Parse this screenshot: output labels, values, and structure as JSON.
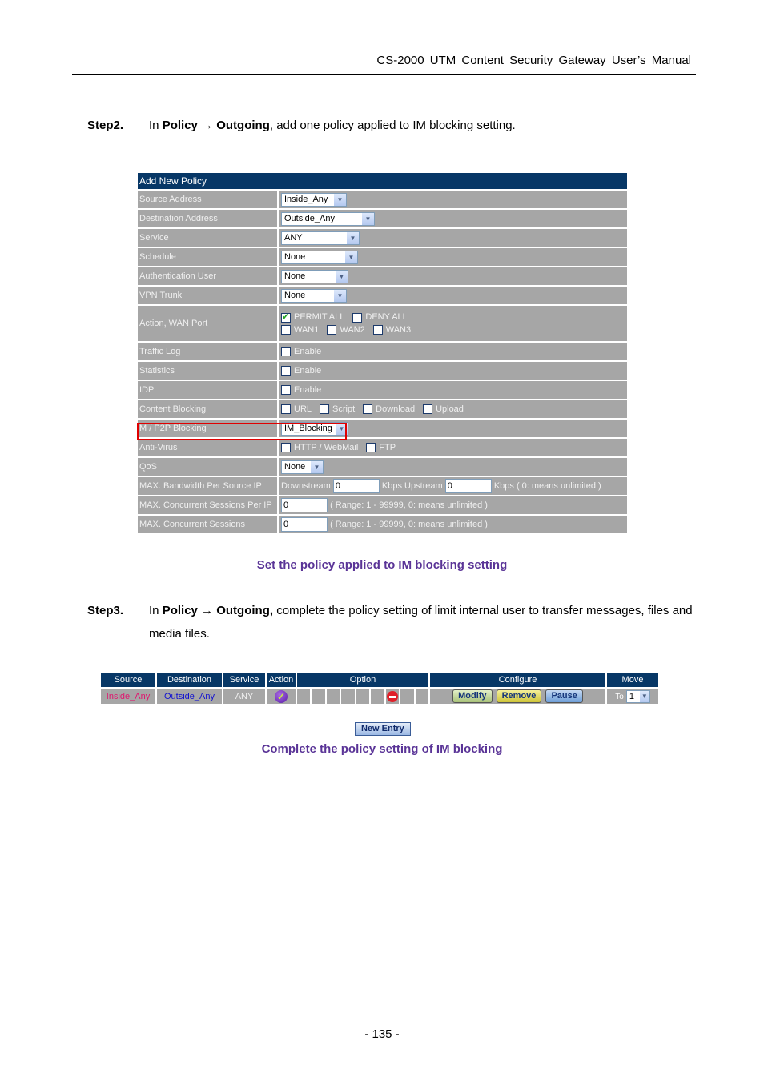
{
  "header": {
    "title": "CS-2000  UTM  Content  Security  Gateway  User’s  Manual"
  },
  "step2": {
    "label": "Step2.",
    "prefix": "In ",
    "path": "Policy → Outgoing",
    "suffix": ", add one policy applied to IM blocking setting."
  },
  "form": {
    "title": "Add New Policy",
    "source_address": {
      "label": "Source Address",
      "value": "Inside_Any"
    },
    "destination_address": {
      "label": "Destination Address",
      "value": "Outside_Any"
    },
    "service": {
      "label": "Service",
      "value": "ANY"
    },
    "schedule": {
      "label": "Schedule",
      "value": "None"
    },
    "auth_user": {
      "label": "Authentication User",
      "value": "None"
    },
    "vpn_trunk": {
      "label": "VPN Trunk",
      "value": "None"
    },
    "action": {
      "label": "Action, WAN Port",
      "permit_all": "PERMIT ALL",
      "permit_all_checked": true,
      "deny_all": "DENY ALL",
      "wan1": "WAN1",
      "wan2": "WAN2",
      "wan3": "WAN3"
    },
    "traffic_log": {
      "label": "Traffic Log",
      "option": "Enable"
    },
    "statistics": {
      "label": "Statistics",
      "option": "Enable"
    },
    "idp": {
      "label": "IDP",
      "option": "Enable"
    },
    "content_blocking": {
      "label": "Content Blocking",
      "url": "URL",
      "script": "Script",
      "download": "Download",
      "upload": "Upload"
    },
    "im_p2p": {
      "label": "M / P2P Blocking",
      "value": "IM_Blocking"
    },
    "anti_virus": {
      "label": "Anti-Virus",
      "http": "HTTP / WebMail",
      "ftp": "FTP"
    },
    "qos": {
      "label": "QoS",
      "value": "None"
    },
    "max_bw": {
      "label": "MAX. Bandwidth Per Source IP",
      "downstream": "Downstream",
      "down_value": "0",
      "upstream": "Kbps Upstream",
      "up_value": "0",
      "note": "Kbps ( 0: means unlimited )"
    },
    "max_sess_ip": {
      "label": "MAX. Concurrent Sessions Per IP",
      "value": "0",
      "note": "( Range: 1 - 99999, 0: means unlimited )"
    },
    "max_sess": {
      "label": "MAX. Concurrent Sessions",
      "value": "0",
      "note": "( Range: 1 - 99999, 0: means unlimited )"
    }
  },
  "caption1": "Set the policy applied to IM blocking setting",
  "step3": {
    "label": "Step3.",
    "prefix": "In ",
    "path": "Policy → Outgoing,",
    "suffix": " complete the policy setting of limit internal user to transfer messages, files and media files."
  },
  "policy_list": {
    "columns": [
      "Source",
      "Destination",
      "Service",
      "Action",
      "Option",
      "Configure",
      "Move"
    ],
    "row": {
      "source": "Inside_Any",
      "destination": "Outside_Any",
      "service": "ANY",
      "action_icon": "permit-check-icon",
      "option_icon": "block-icon",
      "modify": "Modify",
      "remove": "Remove",
      "pause": "Pause",
      "move_to": "To",
      "move_value": "1"
    },
    "source_color": "#e0156e",
    "destination_color": "#1010d0",
    "new_entry": "New Entry"
  },
  "caption2": "Complete the policy setting of IM blocking",
  "footer": {
    "page": "- 135 -"
  }
}
